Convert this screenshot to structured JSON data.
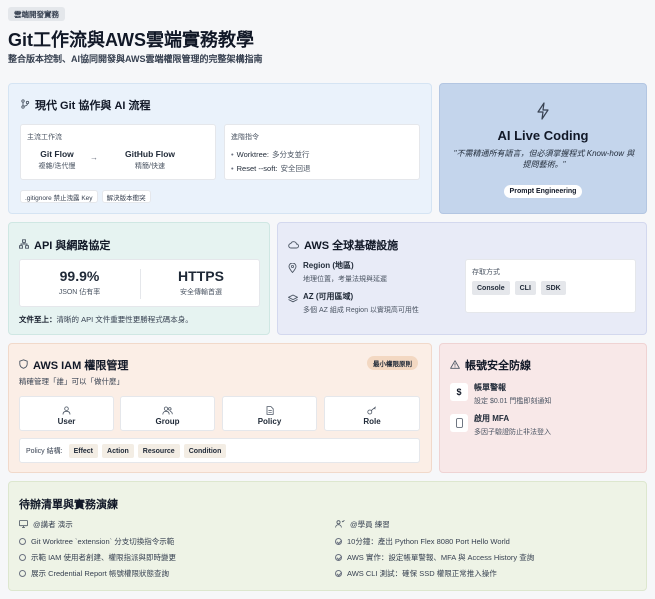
{
  "header": {
    "tag": "雲端開發實務",
    "title": "Git工作流與AWS雲端實務教學",
    "subtitle": "整合版本控制、AI協同開發與AWS雲端權限管理的完整架構指南"
  },
  "git": {
    "title": "現代 Git 協作與 AI 流程",
    "flow_label": "主流工作流",
    "git_flow": "Git Flow",
    "git_flow_desc": "複雜/迭代慢",
    "github_flow": "GitHub Flow",
    "github_flow_desc": "精簡/快速",
    "advanced_label": "進階指令",
    "cmd1_name": "Worktree:",
    "cmd1_desc": "多分支並行",
    "cmd2_name": "Reset --soft:",
    "cmd2_desc": "安全回退",
    "pill1": ".gitignore 禁止洩露 Key",
    "pill2": "解決版本衝突"
  },
  "ai": {
    "title": "AI Live Coding",
    "quote": "\"不需精通所有語言，但必須掌握程式 Know-how 與提問藝術。\"",
    "button": "Prompt Engineering"
  },
  "api": {
    "title": "API 與網路協定",
    "stat1_value": "99.9%",
    "stat1_label": "JSON 佔有率",
    "stat2_value": "HTTPS",
    "stat2_label": "安全傳輸首選",
    "note_bold": "文件至上：",
    "note": "清晰的 API 文件重要性更勝程式碼本身。"
  },
  "aws_infra": {
    "title": "AWS 全球基礎設施",
    "region_title": "Region (地區)",
    "region_desc": "地理位置，考量法規與延遲",
    "az_title": "AZ (可用區域)",
    "az_desc": "多個 AZ 組成 Region 以實現高可用性",
    "access_label": "存取方式",
    "access": [
      "Console",
      "CLI",
      "SDK"
    ]
  },
  "iam": {
    "title": "AWS IAM 權限管理",
    "badge": "最小權限原則",
    "subtitle": "精確管理「誰」可以「做什麼」",
    "items": [
      "User",
      "Group",
      "Policy",
      "Role"
    ],
    "policy_label": "Policy 結構:",
    "policy_parts": [
      "Effect",
      "Action",
      "Resource",
      "Condition"
    ]
  },
  "security": {
    "title": "帳號安全防線",
    "billing_title": "帳單警報",
    "billing_desc": "設定 $0.01 門檻即刻通知",
    "mfa_title": "啟用 MFA",
    "mfa_desc": "多因子驗證防止非法登入"
  },
  "todo": {
    "title": "待辦清單與實務演練",
    "instructor_label": "@講者 演示",
    "instructor_items": [
      "Git Worktree `extension` 分支切換指令示範",
      "示範 IAM 使用者創建、權限指派與即時變更",
      "展示 Credential Report 帳號權限狀態查詢"
    ],
    "student_label": "@學員 練習",
    "student_items": [
      "10分鐘：產出 Python Flex 8080 Port Hello World",
      "AWS 實作：設定帳單警報、MFA 與 Access History 查詢",
      "AWS CLI 測試：確保 SSD 權限正常推入操作"
    ]
  }
}
